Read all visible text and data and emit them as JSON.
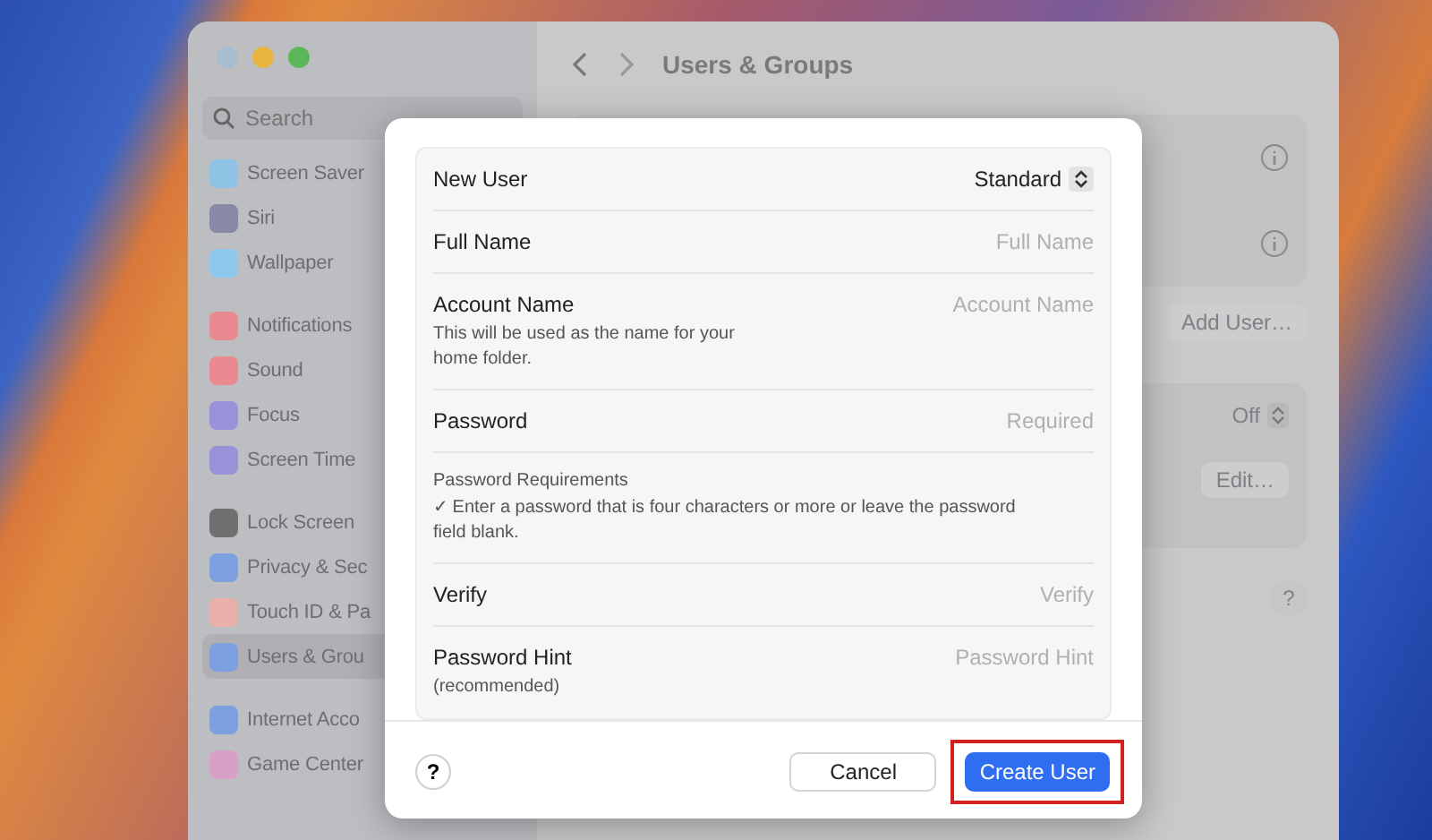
{
  "window": {
    "title": "Users & Groups"
  },
  "search": {
    "placeholder": "Search"
  },
  "sidebar": {
    "groups": [
      [
        {
          "label": "Screen Saver",
          "color": "#8ec3e6",
          "selected": false
        },
        {
          "label": "Siri",
          "color": "#8a8aa8",
          "selected": false
        },
        {
          "label": "Wallpaper",
          "color": "#8ec8ec",
          "selected": false
        }
      ],
      [
        {
          "label": "Notifications",
          "color": "#e88a90",
          "selected": false
        },
        {
          "label": "Sound",
          "color": "#e88a90",
          "selected": false
        },
        {
          "label": "Focus",
          "color": "#9a92d8",
          "selected": false
        },
        {
          "label": "Screen Time",
          "color": "#9a92d8",
          "selected": false
        }
      ],
      [
        {
          "label": "Lock Screen",
          "color": "#707070",
          "selected": false
        },
        {
          "label": "Privacy & Sec",
          "color": "#7ea0e0",
          "selected": false
        },
        {
          "label": "Touch ID & Pa",
          "color": "#e8b0a8",
          "selected": false
        },
        {
          "label": "Users & Grou",
          "color": "#7ea0e0",
          "selected": true
        }
      ],
      [
        {
          "label": "Internet Acco",
          "color": "#7ea0e0",
          "selected": false
        },
        {
          "label": "Game Center",
          "color": "#d8a0c8",
          "selected": false
        }
      ]
    ]
  },
  "main": {
    "add_user_button": "Add User…",
    "auto_login": {
      "value": "Off"
    },
    "edit_button": "Edit…"
  },
  "dialog": {
    "rows": [
      {
        "kind": "popup",
        "label": "New User",
        "value": "Standard"
      },
      {
        "kind": "field",
        "label": "Full Name",
        "placeholder": "Full Name"
      },
      {
        "kind": "field",
        "label": "Account Name",
        "sublabel": "This will be used as the name for your home folder.",
        "placeholder": "Account Name"
      },
      {
        "kind": "field",
        "label": "Password",
        "placeholder": "Required"
      },
      {
        "kind": "note",
        "label": "Password Requirements",
        "sublabel": "✓ Enter a password that is four characters or more or leave the password field blank."
      },
      {
        "kind": "field",
        "label": "Verify",
        "placeholder": "Verify"
      },
      {
        "kind": "field",
        "label": "Password Hint",
        "sublabel": "(recommended)",
        "placeholder": "Password Hint"
      }
    ],
    "help": "?",
    "buttons": [
      {
        "label": "Cancel",
        "kind": "secondary",
        "highlighted": false
      },
      {
        "label": "Create User",
        "kind": "primary",
        "highlighted": true
      }
    ]
  }
}
